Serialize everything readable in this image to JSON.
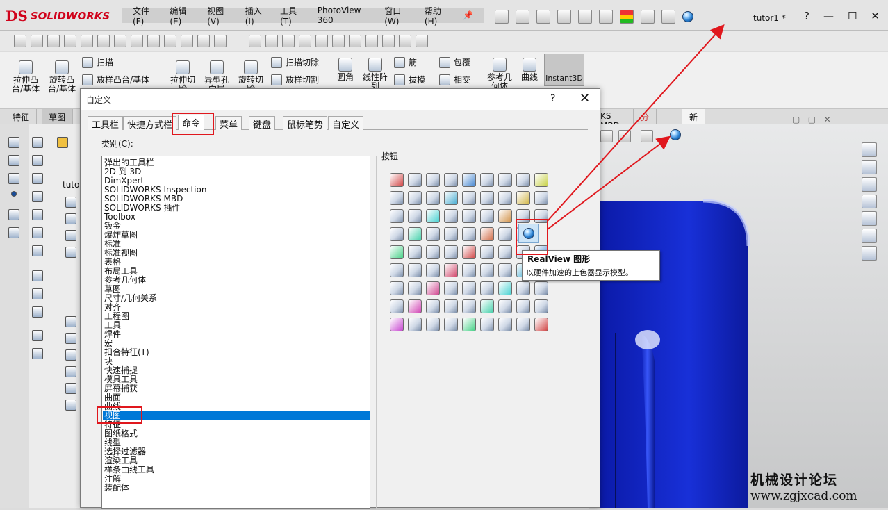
{
  "app": {
    "logo_ds": "DS",
    "logo_text": "SOLIDWORKS",
    "doc_title": "tutor1 *"
  },
  "menu": [
    "文件(F)",
    "编辑(E)",
    "视图(V)",
    "插入(I)",
    "工具(T)",
    "PhotoView 360",
    "窗口(W)",
    "帮助(H)"
  ],
  "winctl": {
    "help": "?",
    "minimize": "—",
    "maximize": "☐",
    "close": "✕"
  },
  "ribbon": {
    "extrude_boss": "拉伸凸\n台/基体",
    "revolve_boss": "旋转凸\n台/基体",
    "sweep": "扫描",
    "loft_boss": "放样凸台/基体",
    "extrude_cut": "拉伸切\n除",
    "hole_wizard": "异型孔\n向导",
    "revolve_cut": "旋转切\n除",
    "swept_cut": "扫描切除",
    "lofted_cut": "放样切割",
    "fillet": "圆角",
    "linear_pattern": "线性阵\n列",
    "rib": "筋",
    "draft": "拔模",
    "wrap": "包覆",
    "intersect": "相交",
    "ref_geometry": "参考几\n何体",
    "curves": "曲线",
    "instant3d": "Instant3D"
  },
  "cm_tabs": [
    "特征",
    "草图"
  ],
  "view_tabs": [
    "KS MBD",
    "分析准备",
    "新选项卡"
  ],
  "dialog": {
    "title": "自定义",
    "help": "?",
    "close": "✕",
    "tabs": [
      "工具栏",
      "快捷方式栏",
      "命令",
      "菜单",
      "键盘",
      "鼠标笔势",
      "自定义"
    ],
    "active_tab": "命令",
    "category_label": "类别(C):",
    "buttons_label": "按钮",
    "categories": [
      "弹出的工具栏",
      "2D 到 3D",
      "DimXpert",
      "SOLIDWORKS Inspection",
      "SOLIDWORKS MBD",
      "SOLIDWORKS 插件",
      "Toolbox",
      "钣金",
      "爆炸草图",
      "标准",
      "标准视图",
      "表格",
      "布局工具",
      "参考几何体",
      "草图",
      "尺寸/几何关系",
      "对齐",
      "工程图",
      "工具",
      "焊件",
      "宏",
      "扣合特征(T)",
      "块",
      "快速捕捉",
      "模具工具",
      "屏幕捕获",
      "曲面",
      "曲线",
      "视图",
      "特征",
      "图纸格式",
      "线型",
      "选择过滤器",
      "渲染工具",
      "样条曲线工具",
      "注解",
      "装配体"
    ],
    "selected_category": "视图"
  },
  "tooltip": {
    "title": "RealView 图形",
    "desc": "以硬件加速的上色器显示模型。"
  },
  "tree": {
    "root": "tuto"
  },
  "watermark": {
    "line1": "机械设计论坛",
    "line2": "www.zgjxcad.com"
  },
  "colors": {
    "accent_red": "#e0171d",
    "selection_blue": "#0078d7",
    "model_blue": "#1a2fd6"
  }
}
